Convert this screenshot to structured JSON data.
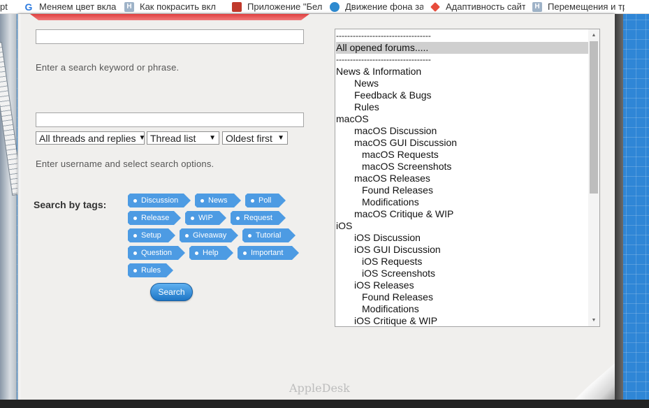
{
  "bookmarks": [
    {
      "icon_text": "",
      "label": "pt",
      "color": "#ffffff"
    },
    {
      "icon_text": "G",
      "label": "Меняем цвет вкла",
      "color": "#2d7be0"
    },
    {
      "icon_text": "H",
      "label": "Как покрасить вкл",
      "color": "#9fb3c8"
    },
    {
      "icon_text": "",
      "label": "Приложение \"Бель",
      "color": "#c0392b"
    },
    {
      "icon_text": "",
      "label": "Движение фона за",
      "color": "#2d8ad0"
    },
    {
      "icon_text": "",
      "label": "Адаптивность сайт",
      "color": "#e74c3c"
    },
    {
      "icon_text": "H",
      "label": "Перемещения и тр",
      "color": "#9fb3c8"
    }
  ],
  "search": {
    "keyword_value": "",
    "keyword_hint": "Enter a search keyword or phrase.",
    "user_value": "",
    "user_hint": "Enter username and select search options."
  },
  "options": {
    "scope": "All threads and replies",
    "display": "Thread list",
    "order": "Oldest first"
  },
  "tags": {
    "label": "Search by tags:",
    "items": [
      "Discussion",
      "News",
      "Poll",
      "Release",
      "WIP",
      "Request",
      "Setup",
      "Giveaway",
      "Tutorial",
      "Question",
      "Help",
      "Important",
      "Rules"
    ]
  },
  "search_button": "Search",
  "forums": {
    "items": [
      {
        "label": "----------------------------------",
        "level": 0,
        "separator": true
      },
      {
        "label": "All opened forums.....",
        "level": 0,
        "selected": true
      },
      {
        "label": "----------------------------------",
        "level": 0,
        "separator": true
      },
      {
        "label": "News & Information",
        "level": 0
      },
      {
        "label": "News",
        "level": 1
      },
      {
        "label": "Feedback & Bugs",
        "level": 1
      },
      {
        "label": "Rules",
        "level": 1
      },
      {
        "label": "macOS",
        "level": 0
      },
      {
        "label": "macOS Discussion",
        "level": 1
      },
      {
        "label": "macOS GUI Discussion",
        "level": 1
      },
      {
        "label": "macOS Requests",
        "level": 2
      },
      {
        "label": "macOS Screenshots",
        "level": 2
      },
      {
        "label": "macOS Releases",
        "level": 1
      },
      {
        "label": "Found Releases",
        "level": 2
      },
      {
        "label": "Modifications",
        "level": 2
      },
      {
        "label": "macOS Critique & WIP",
        "level": 1
      },
      {
        "label": "iOS",
        "level": 0
      },
      {
        "label": "iOS Discussion",
        "level": 1
      },
      {
        "label": "iOS GUI Discussion",
        "level": 1
      },
      {
        "label": "iOS Requests",
        "level": 2
      },
      {
        "label": "iOS Screenshots",
        "level": 2
      },
      {
        "label": "iOS Releases",
        "level": 1
      },
      {
        "label": "Found Releases",
        "level": 2
      },
      {
        "label": "Modifications",
        "level": 2
      },
      {
        "label": "iOS Critique & WIP",
        "level": 1
      }
    ]
  },
  "footer": {
    "logo": "AppleDesk"
  },
  "colors": {
    "tag": "#4d9be3",
    "button": "#1e76c6",
    "background": "#2f86d6"
  }
}
